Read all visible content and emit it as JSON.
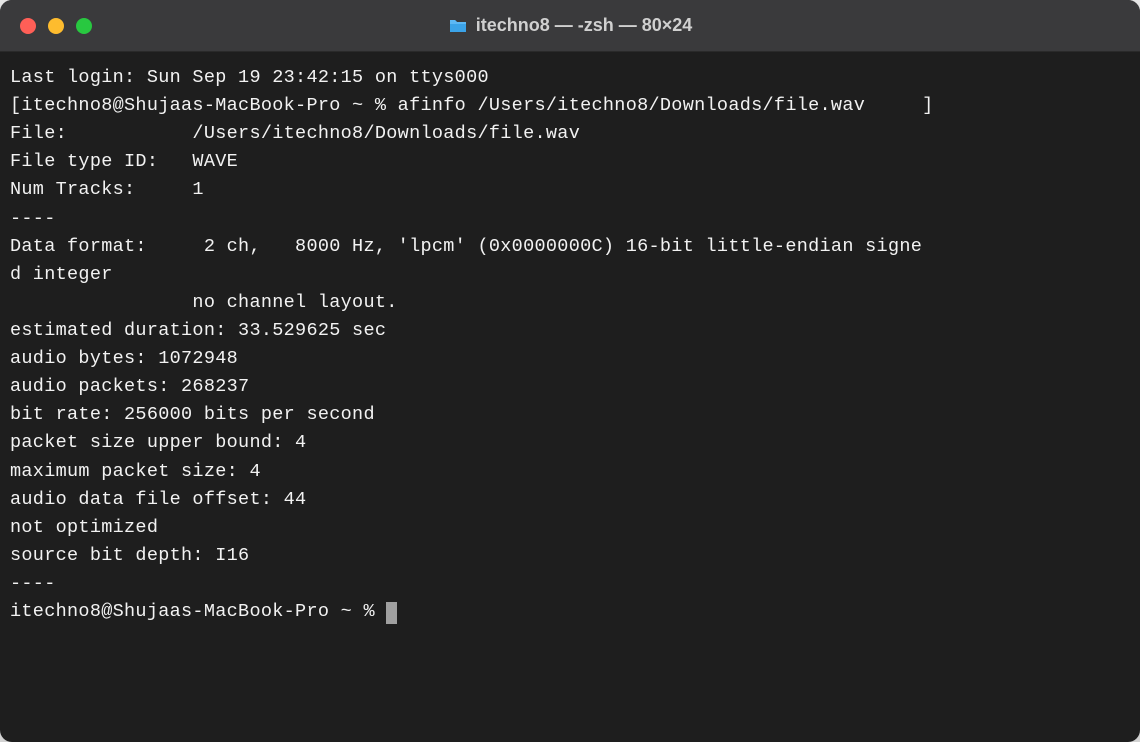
{
  "window": {
    "title": "itechno8 — -zsh — 80×24"
  },
  "terminal": {
    "last_login": "Last login: Sun Sep 19 23:42:15 on ttys000",
    "prompt_line": "[itechno8@Shujaas-MacBook-Pro ~ % afinfo /Users/itechno8/Downloads/file.wav     ]",
    "file_line": "File:           /Users/itechno8/Downloads/file.wav",
    "file_type": "File type ID:   WAVE",
    "num_tracks": "Num Tracks:     1",
    "sep1": "----",
    "data_format_1": "Data format:     2 ch,   8000 Hz, 'lpcm' (0x0000000C) 16-bit little-endian signe",
    "data_format_2": "d integer",
    "channel_layout": "                no channel layout.",
    "duration": "estimated duration: 33.529625 sec",
    "audio_bytes": "audio bytes: 1072948",
    "audio_packets": "audio packets: 268237",
    "bit_rate": "bit rate: 256000 bits per second",
    "packet_upper": "packet size upper bound: 4",
    "max_packet": "maximum packet size: 4",
    "file_offset": "audio data file offset: 44",
    "not_optimized": "not optimized",
    "bit_depth": "source bit depth: I16",
    "sep2": "----",
    "prompt2": "itechno8@Shujaas-MacBook-Pro ~ % "
  }
}
